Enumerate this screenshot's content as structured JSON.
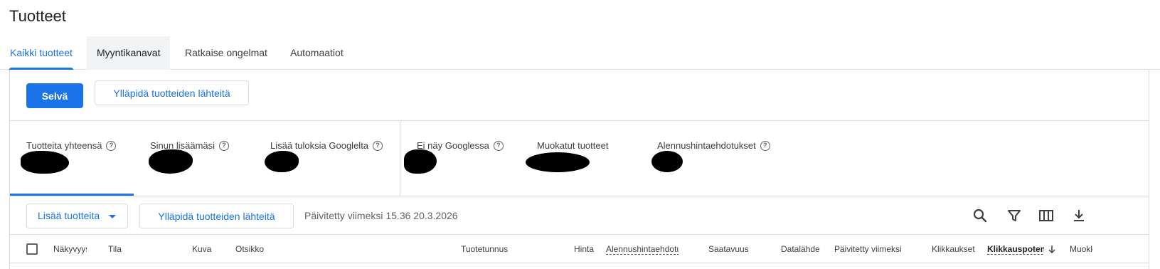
{
  "page": {
    "title": "Tuotteet"
  },
  "tabs": [
    {
      "label": "Kaikki tuotteet",
      "active": true
    },
    {
      "label": "Myyntikanavat",
      "active": false
    },
    {
      "label": "Ratkaise ongelmat",
      "active": false
    },
    {
      "label": "Automaatiot",
      "active": false
    }
  ],
  "actions": {
    "primary_label": "Selvä",
    "manage_sources_label": "Ylläpidä tuotteiden lähteitä"
  },
  "stats": [
    {
      "label": "Tuotteita yhteensä",
      "help": true
    },
    {
      "label": "Sinun lisäämäsi",
      "help": true
    },
    {
      "label": "Lisää tuloksia Googlelta",
      "help": true
    },
    {
      "label": "Ei näy Googlessa",
      "help": true
    },
    {
      "label": "Muokatut tuotteet",
      "help": false
    },
    {
      "label": "Alennushintaehdotukset",
      "help": true
    }
  ],
  "toolbar": {
    "add_products_label": "Lisää tuotteita",
    "manage_sources_label": "Ylläpidä tuotteiden lähteitä",
    "updated_text": "Päivitetty viimeksi 15.36 20.3.2026"
  },
  "table": {
    "columns": [
      "Näkyvyys",
      "Tila",
      "Kuva",
      "Otsikko",
      "Tuotetunnus",
      "Hinta",
      "Alennushintaehdotukset",
      "Saatavuus",
      "Datalähde",
      "Päivitetty viimeksi",
      "Klikkaukset",
      "Klikkauspotentiaali",
      "Muokkaa"
    ]
  },
  "colors": {
    "accent": "#1a73e8",
    "border": "#dadce0",
    "text": "#202124",
    "muted": "#5f6368"
  },
  "icons": [
    "help-icon",
    "search-icon",
    "filter-icon",
    "columns-icon",
    "download-icon",
    "caret-down-icon",
    "arrow-down-icon"
  ]
}
